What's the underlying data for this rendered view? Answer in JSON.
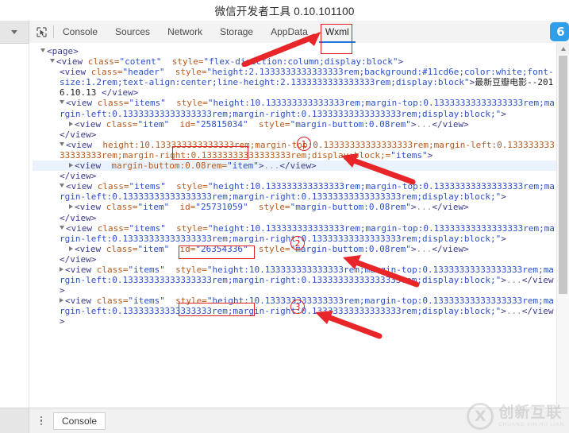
{
  "window": {
    "title": "微信开发者工具 0.10.101100"
  },
  "toolbar": {
    "dropdown_icon": "chevron-down-icon",
    "inspect_icon": "inspect-element-icon",
    "tabs": [
      {
        "label": "Console",
        "active": false
      },
      {
        "label": "Sources",
        "active": false
      },
      {
        "label": "Network",
        "active": false
      },
      {
        "label": "Storage",
        "active": false
      },
      {
        "label": "AppData",
        "active": false
      },
      {
        "label": "Wxml",
        "active": true
      }
    ],
    "corner_icon_glyph": "6"
  },
  "code": {
    "lines": [
      {
        "indent": "i1",
        "marker": "open",
        "selected": false,
        "parts": [
          {
            "c": "tag",
            "t": "<page>"
          }
        ]
      },
      {
        "indent": "i2",
        "marker": "open",
        "selected": false,
        "parts": [
          {
            "c": "tag",
            "t": "<view "
          },
          {
            "c": "attr",
            "t": "class="
          },
          {
            "c": "val",
            "t": "\"cotent\""
          },
          {
            "c": "attr",
            "t": "  style="
          },
          {
            "c": "val",
            "t": "\"flex-direction:column;display:block\""
          },
          {
            "c": "tag",
            "t": ">"
          }
        ]
      },
      {
        "indent": "i3",
        "marker": "none",
        "selected": false,
        "parts": [
          {
            "c": "tag",
            "t": "<view "
          },
          {
            "c": "attr",
            "t": "class="
          },
          {
            "c": "val",
            "t": "\"header\""
          },
          {
            "c": "attr",
            "t": "  style="
          },
          {
            "c": "val",
            "t": "\"height:2.1333333333333333rem;background:#11cd6e;color:white;font-size:1.2rem;text-align:center;line-height:2.1333333333333333rem;display:block\""
          },
          {
            "c": "tag",
            "t": ">"
          },
          {
            "c": "txtc",
            "t": "最新豆瓣电影--2016.10.13 "
          },
          {
            "c": "tag",
            "t": "</view>"
          }
        ]
      },
      {
        "indent": "i3",
        "marker": "open",
        "selected": false,
        "parts": [
          {
            "c": "tag",
            "t": "<view "
          },
          {
            "c": "attr",
            "t": "class="
          },
          {
            "c": "val",
            "t": "\"items\""
          },
          {
            "c": "attr",
            "t": "  style="
          },
          {
            "c": "val",
            "t": "\"height:10.133333333333333rem;margin-top:0.13333333333333333rem;margin-left:0.13333333333333333rem;margin-right:0.13333333333333333rem;display:block;\""
          },
          {
            "c": "tag",
            "t": ">"
          }
        ]
      },
      {
        "indent": "i4",
        "marker": "closed",
        "selected": false,
        "parts": [
          {
            "c": "tag",
            "t": "<view "
          },
          {
            "c": "attr",
            "t": "class="
          },
          {
            "c": "val",
            "t": "\"item\""
          },
          {
            "c": "attr",
            "t": "  id="
          },
          {
            "c": "val",
            "t": "\"25815034\""
          },
          {
            "c": "attr",
            "t": "  style="
          },
          {
            "c": "val",
            "t": "\"margin-buttom:0.08rem\""
          },
          {
            "c": "tag",
            "t": ">"
          },
          {
            "c": "dots",
            "t": "..."
          },
          {
            "c": "tag",
            "t": "</view>"
          }
        ]
      },
      {
        "indent": "i3",
        "marker": "none",
        "selected": false,
        "parts": [
          {
            "c": "tag",
            "t": "</view>"
          }
        ]
      },
      {
        "indent": "i3",
        "marker": "open",
        "selected": false,
        "parts": [
          {
            "c": "tag",
            "t": "<view "
          },
          {
            "c": "attr",
            "t": " height:10.133333333333333rem;margin-top:0.13333333333333333rem;margin-left:0.13333333333333333rem;margin-right:0.13333333333333333rem;display:block;="
          },
          {
            "c": "val",
            "t": "\"items\""
          },
          {
            "c": "tag",
            "t": ">"
          }
        ]
      },
      {
        "indent": "i4",
        "marker": "closed",
        "selected": true,
        "parts": [
          {
            "c": "tag",
            "t": "<view "
          },
          {
            "c": "attr",
            "t": " margin-buttom:0.08rem="
          },
          {
            "c": "val",
            "t": "\"item\""
          },
          {
            "c": "tag",
            "t": ">"
          },
          {
            "c": "dots",
            "t": "..."
          },
          {
            "c": "tag",
            "t": "</view>"
          }
        ]
      },
      {
        "indent": "i3",
        "marker": "none",
        "selected": false,
        "parts": [
          {
            "c": "tag",
            "t": "</view>"
          }
        ]
      },
      {
        "indent": "i3",
        "marker": "open",
        "selected": false,
        "parts": [
          {
            "c": "tag",
            "t": "<view "
          },
          {
            "c": "attr",
            "t": "class="
          },
          {
            "c": "val",
            "t": "\"items\""
          },
          {
            "c": "attr",
            "t": "  style="
          },
          {
            "c": "val",
            "t": "\"height:10.133333333333333rem;margin-top:0.13333333333333333rem;margin-left:0.13333333333333333rem;margin-right:0.13333333333333333rem;display:block;\""
          },
          {
            "c": "tag",
            "t": ">"
          }
        ]
      },
      {
        "indent": "i4",
        "marker": "closed",
        "selected": false,
        "parts": [
          {
            "c": "tag",
            "t": "<view "
          },
          {
            "c": "attr",
            "t": "class="
          },
          {
            "c": "val",
            "t": "\"item\""
          },
          {
            "c": "attr",
            "t": "  id="
          },
          {
            "c": "val",
            "t": "\"25731059\""
          },
          {
            "c": "attr",
            "t": "  style="
          },
          {
            "c": "val",
            "t": "\"margin-buttom:0.08rem\""
          },
          {
            "c": "tag",
            "t": ">"
          },
          {
            "c": "dots",
            "t": "..."
          },
          {
            "c": "tag",
            "t": "</view>"
          }
        ]
      },
      {
        "indent": "i3",
        "marker": "none",
        "selected": false,
        "parts": [
          {
            "c": "tag",
            "t": "</view>"
          }
        ]
      },
      {
        "indent": "i3",
        "marker": "open",
        "selected": false,
        "parts": [
          {
            "c": "tag",
            "t": "<view "
          },
          {
            "c": "attr",
            "t": "class="
          },
          {
            "c": "val",
            "t": "\"items\""
          },
          {
            "c": "attr",
            "t": "  style="
          },
          {
            "c": "val",
            "t": "\"height:10.133333333333333rem;margin-top:0.13333333333333333rem;margin-left:0.13333333333333333rem;margin-right:0.13333333333333333rem;display:block;\""
          },
          {
            "c": "tag",
            "t": ">"
          }
        ]
      },
      {
        "indent": "i4",
        "marker": "closed",
        "selected": false,
        "parts": [
          {
            "c": "tag",
            "t": "<view "
          },
          {
            "c": "attr",
            "t": "class="
          },
          {
            "c": "val",
            "t": "\"item\""
          },
          {
            "c": "attr",
            "t": "  id="
          },
          {
            "c": "val",
            "t": "\"26354336\""
          },
          {
            "c": "attr",
            "t": "  style="
          },
          {
            "c": "val",
            "t": "\"margin-buttom:0.08rem\""
          },
          {
            "c": "tag",
            "t": ">"
          },
          {
            "c": "dots",
            "t": "..."
          },
          {
            "c": "tag",
            "t": "</view>"
          }
        ]
      },
      {
        "indent": "i3",
        "marker": "none",
        "selected": false,
        "parts": [
          {
            "c": "tag",
            "t": "</view>"
          }
        ]
      },
      {
        "indent": "i3",
        "marker": "closed",
        "selected": false,
        "parts": [
          {
            "c": "tag",
            "t": "<view "
          },
          {
            "c": "attr",
            "t": "class="
          },
          {
            "c": "val",
            "t": "\"items\""
          },
          {
            "c": "attr",
            "t": "  style="
          },
          {
            "c": "val",
            "t": "\"height:10.133333333333333rem;margin-top:0.13333333333333333rem;margin-left:0.13333333333333333rem;margin-right:0.13333333333333333rem;display:block;\""
          },
          {
            "c": "tag",
            "t": ">"
          },
          {
            "c": "dots",
            "t": "..."
          },
          {
            "c": "tag",
            "t": "</view>"
          }
        ]
      },
      {
        "indent": "i3",
        "marker": "closed",
        "selected": false,
        "parts": [
          {
            "c": "tag",
            "t": "<view "
          },
          {
            "c": "attr",
            "t": "class="
          },
          {
            "c": "val",
            "t": "\"items\""
          },
          {
            "c": "attr",
            "t": "  style="
          },
          {
            "c": "val",
            "t": "\"height:10.133333333333333rem;margin-top:0.13333333333333333rem;margin-left:0.13333333333333333rem;margin-right:0.13333333333333333rem;display:block;\""
          },
          {
            "c": "tag",
            "t": ">"
          },
          {
            "c": "dots",
            "t": "..."
          },
          {
            "c": "tag",
            "t": "</view>"
          }
        ]
      }
    ]
  },
  "bottom": {
    "console_label": "Console",
    "kebab_icon": "more-options-icon"
  },
  "annotations": {
    "accent_color": "#e02020",
    "markers": [
      {
        "label": "1"
      },
      {
        "label": "2"
      },
      {
        "label": "3"
      }
    ]
  },
  "watermark": {
    "cn": "创新互联",
    "en": "CHUANG XIN HU LIAN"
  }
}
